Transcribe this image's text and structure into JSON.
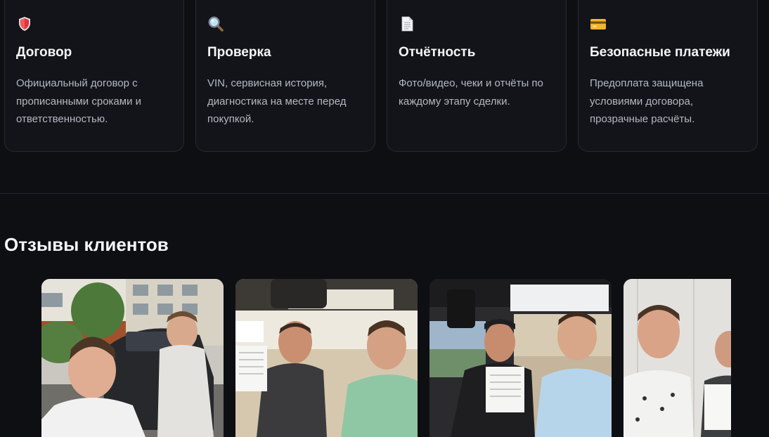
{
  "features": [
    {
      "icon": "shield-icon",
      "title": "Договор",
      "description": "Официальный договор с прописанными сроками и ответственностью."
    },
    {
      "icon": "magnifier-icon",
      "title": "Проверка",
      "description": "VIN, сервисная история, диагностика на месте перед покупкой."
    },
    {
      "icon": "document-icon",
      "title": "Отчётность",
      "description": "Фото/видео, чеки и отчёты по каждому этапу сделки."
    },
    {
      "icon": "credit-card-icon",
      "title": "Безопасные платежи",
      "description": "Предоплата защищена условиями договора, прозрачные расчёты."
    }
  ],
  "reviews": {
    "title": "Отзывы клиентов",
    "photos": [
      {
        "name": "review-photo-1"
      },
      {
        "name": "review-photo-2"
      },
      {
        "name": "review-photo-3"
      },
      {
        "name": "review-photo-4"
      }
    ]
  },
  "colors": {
    "background": "#0d0f13",
    "card": "#121419",
    "card_border": "#262a31",
    "text_primary": "#f4f5f7",
    "text_secondary": "#b3b8c2"
  }
}
